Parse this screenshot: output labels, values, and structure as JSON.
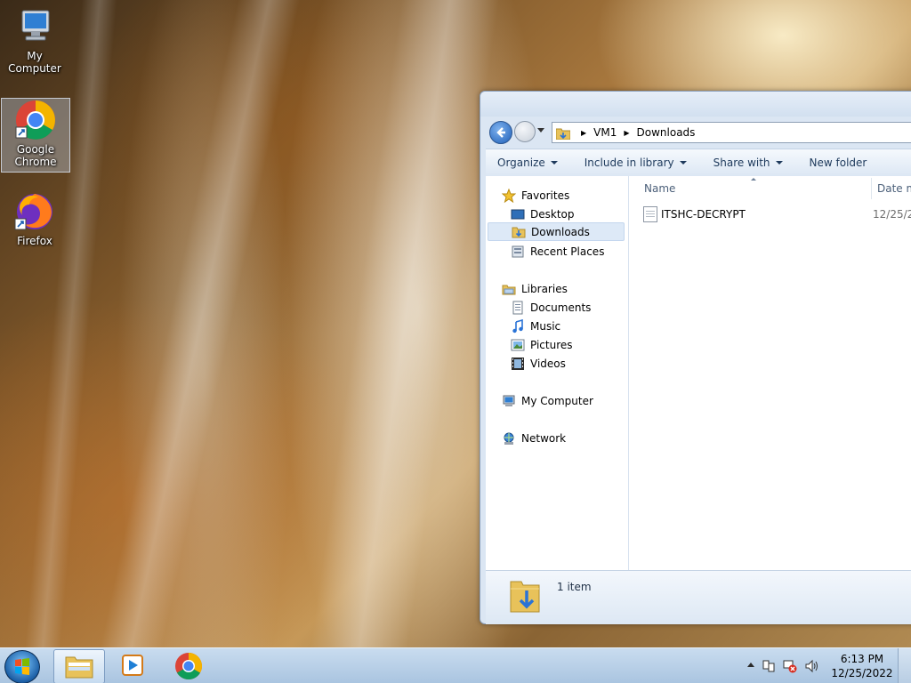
{
  "desktop": {
    "icons": [
      {
        "label": "My Computer"
      },
      {
        "label": "Google Chrome"
      },
      {
        "label": "Firefox"
      }
    ]
  },
  "explorer": {
    "address": {
      "segments": [
        "VM1",
        "Downloads"
      ]
    },
    "toolbar": {
      "organize": "Organize",
      "include_in_library": "Include in library",
      "share_with": "Share with",
      "new_folder": "New folder"
    },
    "nav": {
      "favorites": "Favorites",
      "desktop": "Desktop",
      "downloads": "Downloads",
      "recent_places": "Recent Places",
      "libraries": "Libraries",
      "documents": "Documents",
      "music": "Music",
      "pictures": "Pictures",
      "videos": "Videos",
      "my_computer": "My Computer",
      "network": "Network"
    },
    "columns": {
      "name": "Name",
      "date_modified": "Date m"
    },
    "files": [
      {
        "name": "ITSHC-DECRYPT",
        "date": "12/25/2"
      }
    ],
    "status": {
      "item_count": "1 item"
    }
  },
  "taskbar": {
    "clock_time": "6:13 PM",
    "clock_date": "12/25/2022"
  },
  "colors": {
    "accent": "#1e5fb8",
    "selection": "#dde9f7"
  }
}
